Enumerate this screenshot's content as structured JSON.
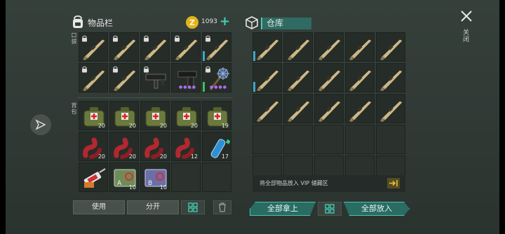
{
  "inventory": {
    "title": "物品栏",
    "pockets_label": "口袋",
    "backpack_label": "背包",
    "pockets": [
      {
        "item": "rifle-icon",
        "locked": true
      },
      {
        "item": "rifle-icon",
        "locked": true
      },
      {
        "item": "rifle-icon",
        "locked": true
      },
      {
        "item": "rifle-icon",
        "locked": true
      },
      {
        "item": "rifle-icon",
        "locked": true
      },
      {
        "item": "rifle-icon",
        "locked": true
      },
      {
        "item": "rifle-icon",
        "locked": true
      },
      {
        "item": "smg-icon",
        "locked": true
      },
      {
        "item": "pistol-icon",
        "locked": false
      },
      {
        "item": "mace-icon",
        "locked": true
      }
    ],
    "backpack": [
      {
        "item": "medkit-icon",
        "qty": "20"
      },
      {
        "item": "medkit-icon",
        "qty": "20"
      },
      {
        "item": "medkit-icon",
        "qty": "20"
      },
      {
        "item": "medkit-icon",
        "qty": "20"
      },
      {
        "item": "medkit-icon",
        "qty": "19"
      },
      {
        "item": "bandage-icon",
        "qty": "20"
      },
      {
        "item": "bandage-icon",
        "qty": "20"
      },
      {
        "item": "bandage-icon",
        "qty": "20"
      },
      {
        "item": "bandage-icon",
        "qty": "12"
      },
      {
        "item": "water-bottle-icon",
        "qty": "17"
      },
      {
        "item": "syringe-kit-icon",
        "qty": ""
      },
      {
        "item": "card-a-icon",
        "qty": "10"
      },
      {
        "item": "card-b-icon",
        "qty": "10"
      },
      {
        "item": "",
        "qty": ""
      },
      {
        "item": "",
        "qty": ""
      }
    ],
    "use_label": "使用",
    "split_label": "分开"
  },
  "currency": {
    "amount": "1093",
    "coin_symbol": "Z"
  },
  "warehouse": {
    "title": "仓库",
    "items": [
      "rifle-icon",
      "rifle-icon",
      "rifle-icon",
      "rifle-icon",
      "rifle-icon",
      "rifle-icon",
      "rifle-icon",
      "rifle-icon",
      "rifle-icon",
      "rifle-icon",
      "rifle-icon",
      "rifle-icon",
      "rifle-icon",
      "rifle-icon",
      "rifle-icon",
      "",
      "",
      "",
      "",
      "",
      "",
      "",
      "",
      "",
      ""
    ],
    "vip_text": "将全部物品放入 VIP 储藏区",
    "take_all_label": "全部拿上",
    "put_all_label": "全部放入"
  },
  "close_label": "关闭",
  "colors": {
    "accent": "#3fd3b5",
    "teal_button": "#2a6b63",
    "coin": "#e3b21d",
    "quantity_bar": "#3fa9c9",
    "quantity_bar_full": "#3fbf5c"
  }
}
